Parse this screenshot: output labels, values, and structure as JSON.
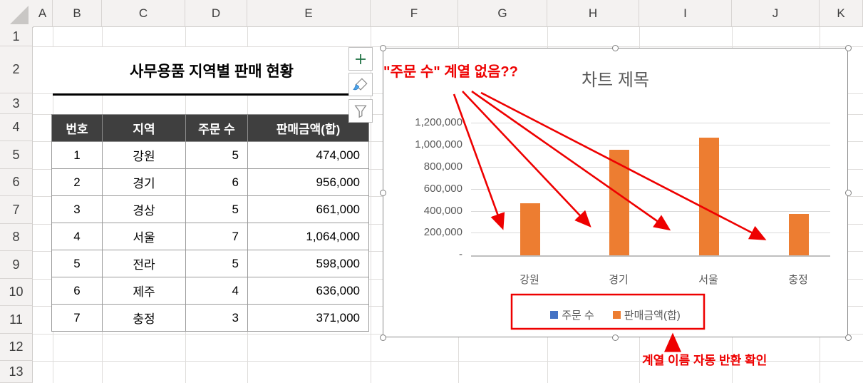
{
  "sheet": {
    "column_headers": [
      "A",
      "B",
      "C",
      "D",
      "E",
      "F",
      "G",
      "H",
      "I",
      "J",
      "K"
    ],
    "row_headers": [
      "1",
      "2",
      "3",
      "4",
      "5",
      "6",
      "7",
      "8",
      "9",
      "10",
      "11",
      "12",
      "13"
    ],
    "title": "사무용품 지역별 판매 현황"
  },
  "table": {
    "headers": [
      "번호",
      "지역",
      "주문 수",
      "판매금액(합)"
    ],
    "rows": [
      [
        "1",
        "강원",
        "5",
        "474,000"
      ],
      [
        "2",
        "경기",
        "6",
        "956,000"
      ],
      [
        "3",
        "경상",
        "5",
        "661,000"
      ],
      [
        "4",
        "서울",
        "7",
        "1,064,000"
      ],
      [
        "5",
        "전라",
        "5",
        "598,000"
      ],
      [
        "6",
        "제주",
        "4",
        "636,000"
      ],
      [
        "7",
        "충정",
        "3",
        "371,000"
      ]
    ]
  },
  "chart_tools": {
    "elements_button": "chart-elements-plus",
    "styles_button": "chart-styles-brush",
    "filters_button": "chart-filters-funnel"
  },
  "chart_data": {
    "type": "bar",
    "title": "차트 제목",
    "categories": [
      "강원",
      "경기",
      "서울",
      "충정"
    ],
    "series": [
      {
        "name": "주문 수",
        "color": "#4472C4",
        "values": [
          null,
          null,
          null,
          null
        ]
      },
      {
        "name": "판매금액(합)",
        "color": "#ED7D31",
        "values": [
          474000,
          956000,
          1064000,
          371000
        ]
      }
    ],
    "ylim": [
      0,
      1200000
    ],
    "ytick_labels": [
      "1,200,000",
      "1,000,000",
      "800,000",
      "600,000",
      "400,000",
      "200,000",
      "-"
    ],
    "grid": true,
    "legend_position": "bottom"
  },
  "annotations": {
    "missing_series": "\"주문 수\" 계열 없음??",
    "series_name_check": "계열 이름 자동 반환 확인"
  },
  "colors": {
    "bar_orange": "#ED7D31",
    "legend_blue": "#4472C4",
    "annotation_red": "#EE0000",
    "table_header_bg": "#3F3F3F",
    "chart_text_gray": "#595959",
    "chart_gridline": "#D9D9D9"
  }
}
